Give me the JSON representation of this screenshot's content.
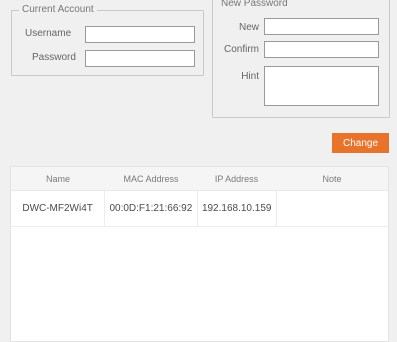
{
  "current_account": {
    "title": "Current Account",
    "username_label": "Username",
    "username_value": "",
    "password_label": "Password",
    "password_value": ""
  },
  "new_password": {
    "title": "New Password",
    "new_label": "New",
    "new_value": "",
    "confirm_label": "Confirm",
    "confirm_value": "",
    "hint_label": "Hint",
    "hint_value": ""
  },
  "change_button_label": "Change",
  "table": {
    "columns": [
      "Name",
      "MAC Address",
      "IP Address",
      "Note"
    ],
    "rows": [
      [
        "DWC-MF2Wi4T",
        "00:0D:F1:21:66:92",
        "192.168.10.159",
        ""
      ]
    ]
  },
  "colors": {
    "accent": "#e8742b"
  }
}
